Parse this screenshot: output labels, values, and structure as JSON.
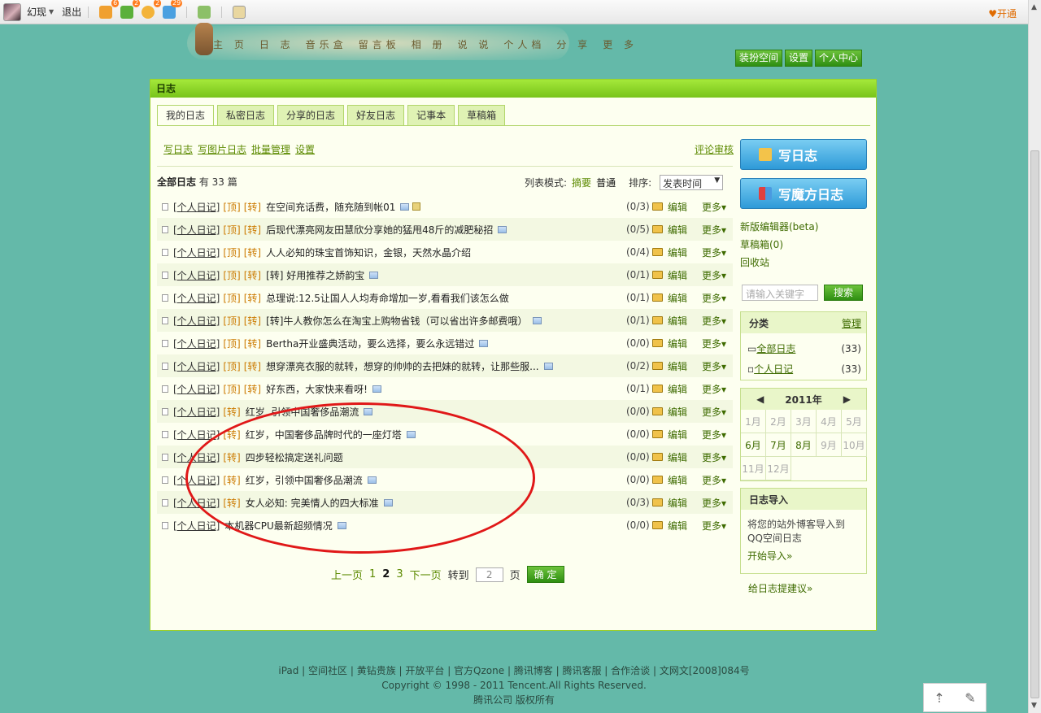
{
  "topbar": {
    "username": "幻现",
    "logout": "退出",
    "badges": [
      "6",
      "2",
      "2",
      "29"
    ],
    "vip": "开通"
  },
  "nav": [
    "主 页",
    "日 志",
    "音乐盒",
    "留言板",
    "相 册",
    "说 说",
    "个人档",
    "分 享",
    "更 多"
  ],
  "topbuttons": [
    "装扮空间",
    "设置",
    "个人中心"
  ],
  "panel": {
    "title": "日志",
    "tabs": [
      "我的日志",
      "私密日志",
      "分享的日志",
      "好友日志",
      "记事本",
      "草稿箱"
    ],
    "tools": [
      "写日志",
      "写图片日志",
      "批量管理",
      "设置"
    ],
    "review": "评论审核",
    "list_title": "全部日志",
    "list_count": "有 33 篇",
    "list_mode_label": "列表模式:",
    "mode_summary": "摘要",
    "mode_normal": "普通",
    "sort_label": "排序:",
    "sort_value": "发表时间"
  },
  "rows": [
    {
      "cat": "[个人日记]",
      "top": "[顶]",
      "zhuan": "[转]",
      "title": "在空间充话费，随充随到帐01",
      "count": "(0/3)"
    },
    {
      "cat": "[个人日记]",
      "top": "[顶]",
      "zhuan": "[转]",
      "title": "后现代漂亮网友田慧欣分享她的猛甩48斤的减肥秘招",
      "count": "(0/5)"
    },
    {
      "cat": "[个人日记]",
      "top": "[顶]",
      "zhuan": "[转]",
      "title": "人人必知的珠宝首饰知识，金银，天然水晶介绍",
      "count": "(0/4)"
    },
    {
      "cat": "[个人日记]",
      "top": "[顶]",
      "zhuan": "[转]",
      "title": "[转] 好用推荐之娇韵宝",
      "count": "(0/1)"
    },
    {
      "cat": "[个人日记]",
      "top": "[顶]",
      "zhuan": "[转]",
      "title": "总理说:12.5让国人人均寿命增加一岁,看看我们该怎么做",
      "count": "(0/1)"
    },
    {
      "cat": "[个人日记]",
      "top": "[顶]",
      "zhuan": "[转]",
      "title": "[转]牛人教你怎么在淘宝上购物省钱（可以省出许多邮费哦）",
      "count": "(0/1)"
    },
    {
      "cat": "[个人日记]",
      "top": "[顶]",
      "zhuan": "[转]",
      "title": "Bertha开业盛典活动，要么选择，要么永远错过",
      "count": "(0/0)"
    },
    {
      "cat": "[个人日记]",
      "top": "[顶]",
      "zhuan": "[转]",
      "title": "想穿漂亮衣服的就转，想穿的帅帅的去把妹的就转，让那些服...",
      "count": "(0/2)"
    },
    {
      "cat": "[个人日记]",
      "top": "[顶]",
      "zhuan": "[转]",
      "title": "好东西，大家快来看呀!",
      "count": "(0/1)"
    },
    {
      "cat": "[个人日记]",
      "top": "",
      "zhuan": "[转]",
      "title": "红岁, 引领中国奢侈品潮流",
      "count": "(0/0)"
    },
    {
      "cat": "[个人日记]",
      "top": "",
      "zhuan": "[转]",
      "title": "红岁，中国奢侈品牌时代的一座灯塔",
      "count": "(0/0)"
    },
    {
      "cat": "[个人日记]",
      "top": "",
      "zhuan": "[转]",
      "title": "四步轻松搞定送礼问题",
      "count": "(0/0)"
    },
    {
      "cat": "[个人日记]",
      "top": "",
      "zhuan": "[转]",
      "title": "红岁，引领中国奢侈品潮流",
      "count": "(0/0)"
    },
    {
      "cat": "[个人日记]",
      "top": "",
      "zhuan": "[转]",
      "title": "女人必知: 完美情人的四大标准",
      "count": "(0/3)"
    },
    {
      "cat": "[个人日记]",
      "top": "",
      "zhuan": "",
      "title": "本机器CPU最新超频情况",
      "count": "(0/0)"
    }
  ],
  "row_edit": "编辑",
  "row_more": "更多▾",
  "pager": {
    "prev": "上一页",
    "pages": [
      "1",
      "2",
      "3"
    ],
    "current": "2",
    "next": "下一页",
    "goto": "转到",
    "input": "2",
    "unit": "页",
    "ok": "确 定"
  },
  "side": {
    "write": "写日志",
    "write_magic": "写魔方日志",
    "new_editor": "新版编辑器(beta)",
    "drafts": "草稿箱(0)",
    "recycle": "回收站",
    "search_placeholder": "请输入关键字",
    "search_btn": "搜索",
    "category_title": "分类",
    "category_manage": "管理",
    "categories": [
      {
        "name": "全部日志",
        "count": "(33)"
      },
      {
        "name": "个人日记",
        "count": "(33)"
      }
    ],
    "calendar_year": "2011年",
    "months": [
      "1月",
      "2月",
      "3月",
      "4月",
      "5月",
      "6月",
      "7月",
      "8月",
      "9月",
      "10月",
      "11月",
      "12月"
    ],
    "import_title": "日志导入",
    "import_text": "将您的站外博客导入到QQ空间日志",
    "import_link": "开始导入»",
    "suggest": "给日志提建议»"
  },
  "footer": {
    "links": "iPad | 空间社区 | 黄钻贵族 | 开放平台 | 官方Qzone | 腾讯博客 | 腾讯客服 | 合作洽谈 | 文网文[2008]084号",
    "copyright": "Copyright © 1998 - 2011 Tencent.All Rights Reserved.",
    "company": "腾讯公司  版权所有"
  }
}
